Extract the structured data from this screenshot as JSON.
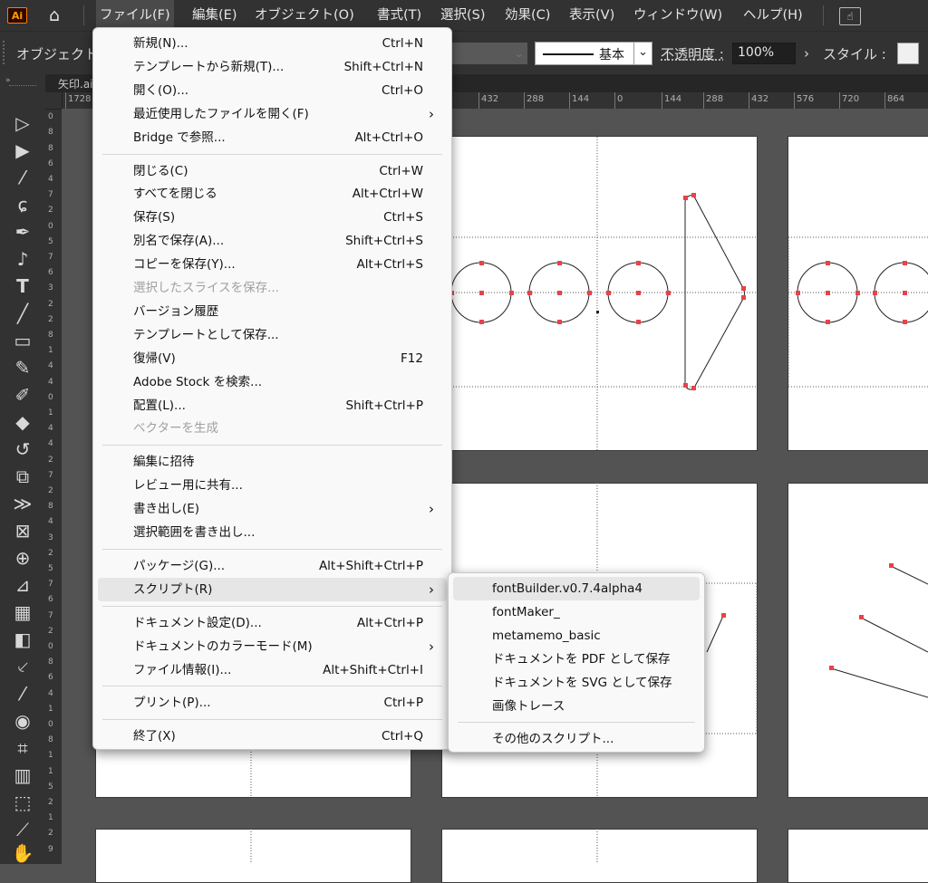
{
  "app": {
    "logo": "Ai",
    "home_icon": "home-icon"
  },
  "menubar": {
    "items": [
      "ファイル(F)",
      "編集(E)",
      "オブジェクト(O)",
      "書式(T)",
      "選択(S)",
      "効果(C)",
      "表示(V)",
      "ウィンドウ(W)",
      "ヘルプ(H)"
    ]
  },
  "control": {
    "object_label": "オブジェクト",
    "stroke_style": "基本",
    "opacity_label": "不透明度 :",
    "opacity_value": "100%",
    "style_label": "スタイル :"
  },
  "document": {
    "tab_label": "矢印.ai"
  },
  "rulers": {
    "h": [
      "1728",
      "432",
      "288",
      "144",
      "0",
      "144",
      "288",
      "432",
      "576",
      "720",
      "864"
    ],
    "v": [
      "1",
      "0",
      "8",
      "8",
      "6",
      "4",
      "7",
      "2",
      "0",
      "5",
      "7",
      "6",
      "3",
      "2",
      "2",
      "8",
      "1",
      "4",
      "4",
      "0",
      "1",
      "4",
      "4",
      "2",
      "7",
      "2",
      "8",
      "4",
      "3",
      "2",
      "5",
      "7",
      "6",
      "7",
      "2",
      "0",
      "8",
      "6",
      "4",
      "1",
      "0",
      "8",
      "1",
      "1",
      "5",
      "2",
      "1",
      "2",
      "9"
    ]
  },
  "file_menu": {
    "items": [
      {
        "label": "新規(N)...",
        "shortcut": "Ctrl+N"
      },
      {
        "label": "テンプレートから新規(T)...",
        "shortcut": "Shift+Ctrl+N"
      },
      {
        "label": "開く(O)...",
        "shortcut": "Ctrl+O"
      },
      {
        "label": "最近使用したファイルを開く(F)",
        "submenu": true
      },
      {
        "label": "Bridge で参照...",
        "shortcut": "Alt+Ctrl+O"
      },
      {
        "sep": true
      },
      {
        "label": "閉じる(C)",
        "shortcut": "Ctrl+W"
      },
      {
        "label": "すべてを閉じる",
        "shortcut": "Alt+Ctrl+W"
      },
      {
        "label": "保存(S)",
        "shortcut": "Ctrl+S"
      },
      {
        "label": "別名で保存(A)...",
        "shortcut": "Shift+Ctrl+S"
      },
      {
        "label": "コピーを保存(Y)...",
        "shortcut": "Alt+Ctrl+S"
      },
      {
        "label": "選択したスライスを保存...",
        "disabled": true
      },
      {
        "label": "バージョン履歴"
      },
      {
        "label": "テンプレートとして保存..."
      },
      {
        "label": "復帰(V)",
        "shortcut": "F12"
      },
      {
        "label": "Adobe Stock を検索..."
      },
      {
        "label": "配置(L)...",
        "shortcut": "Shift+Ctrl+P"
      },
      {
        "label": "ベクターを生成",
        "disabled": true
      },
      {
        "sep": true
      },
      {
        "label": "編集に招待"
      },
      {
        "label": "レビュー用に共有..."
      },
      {
        "label": "書き出し(E)",
        "submenu": true
      },
      {
        "label": "選択範囲を書き出し..."
      },
      {
        "sep": true
      },
      {
        "label": "パッケージ(G)...",
        "shortcut": "Alt+Shift+Ctrl+P"
      },
      {
        "label": "スクリプト(R)",
        "submenu": true,
        "highlighted": true
      },
      {
        "sep": true
      },
      {
        "label": "ドキュメント設定(D)...",
        "shortcut": "Alt+Ctrl+P"
      },
      {
        "label": "ドキュメントのカラーモード(M)",
        "submenu": true
      },
      {
        "label": "ファイル情報(I)...",
        "shortcut": "Alt+Shift+Ctrl+I"
      },
      {
        "sep": true
      },
      {
        "label": "プリント(P)...",
        "shortcut": "Ctrl+P"
      },
      {
        "sep": true
      },
      {
        "label": "終了(X)",
        "shortcut": "Ctrl+Q"
      }
    ]
  },
  "script_menu": {
    "items": [
      {
        "label": "fontBuilder.v0.7.4alpha4",
        "highlighted": true
      },
      {
        "label": "fontMaker_"
      },
      {
        "label": "metamemo_basic"
      },
      {
        "label": "ドキュメントを PDF として保存"
      },
      {
        "label": "ドキュメントを SVG として保存"
      },
      {
        "label": "画像トレース"
      },
      {
        "sep": true
      },
      {
        "label": "その他のスクリプト..."
      }
    ]
  },
  "colors": {
    "anchor": "#e8424a",
    "accent": "#ff9a00",
    "menu_bg": "#f9f9f9",
    "chrome": "#323232"
  }
}
